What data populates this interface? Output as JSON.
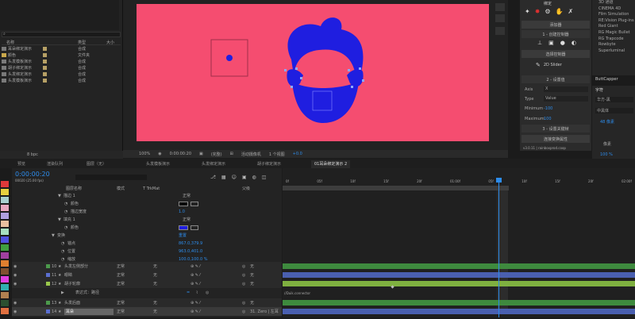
{
  "project": {
    "search_placeholder": "",
    "headers": {
      "name": "名称",
      "label": "",
      "type": "类型",
      "size": "大小"
    },
    "items": [
      {
        "name": "耳朵绑定演示",
        "color": "#b6a065",
        "type": "合成"
      },
      {
        "name": "颜色",
        "color": "#b6a065",
        "type": "文件夹"
      },
      {
        "name": "头发模板演示",
        "color": "#b6a065",
        "type": "合成"
      },
      {
        "name": "胡子绑定演示",
        "color": "#b6a065",
        "type": "合成"
      },
      {
        "name": "头发绑定演示",
        "color": "#b6a065",
        "type": "合成"
      },
      {
        "name": "头发模板演示",
        "color": "#b6a065",
        "type": "合成"
      }
    ],
    "bit_depth": "8 bpc"
  },
  "viewer": {
    "zoom": "100%",
    "timecode": "0:00:00:20",
    "quality": "(完整)",
    "camera": "活动摄像机",
    "views": "1 个视图",
    "exposure": "+0.0"
  },
  "tools": {
    "header": "绑定",
    "buttons": [
      "添加器",
      "1 - 创建控制器",
      "选择控制器",
      "2D Slider",
      "2 - 设置值",
      "3 - 设置关键帧",
      "连接变换属性"
    ],
    "axis_label": "Axis",
    "axis_value": "X",
    "type_label": "Type",
    "type_value": "Value",
    "min_label": "Minimum",
    "min_value": "-100",
    "max_label": "Maximum",
    "max_value": "100",
    "footer": "v3.0.11 | rainboxprod.coop"
  },
  "effects": {
    "items": [
      "3D 通道",
      "CINEMA 4D",
      "Film Simulation",
      "RE:Vision Plug-ins",
      "Red Giant",
      "RG Magic Bullet",
      "RG Trapcode",
      "Rowbyte",
      "Superluminal"
    ],
    "search": "ButtCapper"
  },
  "character": {
    "title": "字符",
    "font": "华方-黑",
    "font_style": "中黑体",
    "size": "48 像素",
    "leading": "像素",
    "scale": "100 %"
  },
  "timeline": {
    "tabs": [
      "预览",
      "渲染队列",
      "图层（无）",
      "头发模板演示",
      "头发绑定演示",
      "胡子绑定演示",
      "01耳朵绑定演示 2"
    ],
    "timecode": "0:00:00:20",
    "fps": "00020 (25.00 fps)",
    "col_source": "图层名称",
    "col_mode": "模式",
    "col_trkmat": "T TrkMat",
    "col_parent": "父级",
    "rows": [
      {
        "name": "描边 1",
        "value": "正常"
      },
      {
        "name": "颜色",
        "value": ""
      },
      {
        "name": "描边宽度",
        "value": "1.0"
      },
      {
        "name": "填充 1",
        "value": "正常"
      },
      {
        "name": "颜色",
        "value": ""
      },
      {
        "name": "变换",
        "value": "重置"
      },
      {
        "name": "锚点",
        "value": "867.0,379.9"
      },
      {
        "name": "位置",
        "value": "963.0,401.0"
      },
      {
        "name": "缩放",
        "value": "100.0,100.0 %"
      }
    ],
    "layers": [
      {
        "num": "10",
        "name": "头发左侧部分",
        "mode": "正常",
        "trk": "无",
        "parent": "无",
        "color": "#4c9a4c"
      },
      {
        "num": "11",
        "name": "眼睛",
        "mode": "正常",
        "trk": "无",
        "parent": "无",
        "color": "#5b6fcf"
      },
      {
        "num": "12",
        "name": "胡子轮廓",
        "mode": "正常",
        "trk": "无",
        "parent": "无",
        "color": "#9ac94c"
      },
      {
        "num": "13",
        "name": "头发后面",
        "mode": "正常",
        "trk": "无",
        "parent": "无",
        "color": "#4c9a4c"
      },
      {
        "num": "14",
        "name": "耳朵",
        "mode": "正常",
        "trk": "无",
        "parent": "31. Zero | 左耳",
        "color": "#5b6fcf"
      }
    ],
    "expression": "表达式：路径",
    "expr_text": "//Duik.connector",
    "ruler": [
      "0f",
      "05f",
      "10f",
      "15f",
      "20f",
      "01:00f",
      "05f",
      "10f",
      "15f",
      "20f",
      "02:00f"
    ]
  },
  "colors": {
    "comp_bg": "#f54d70",
    "figure": "#1f1ee0",
    "accent": "#2d8ceb"
  }
}
